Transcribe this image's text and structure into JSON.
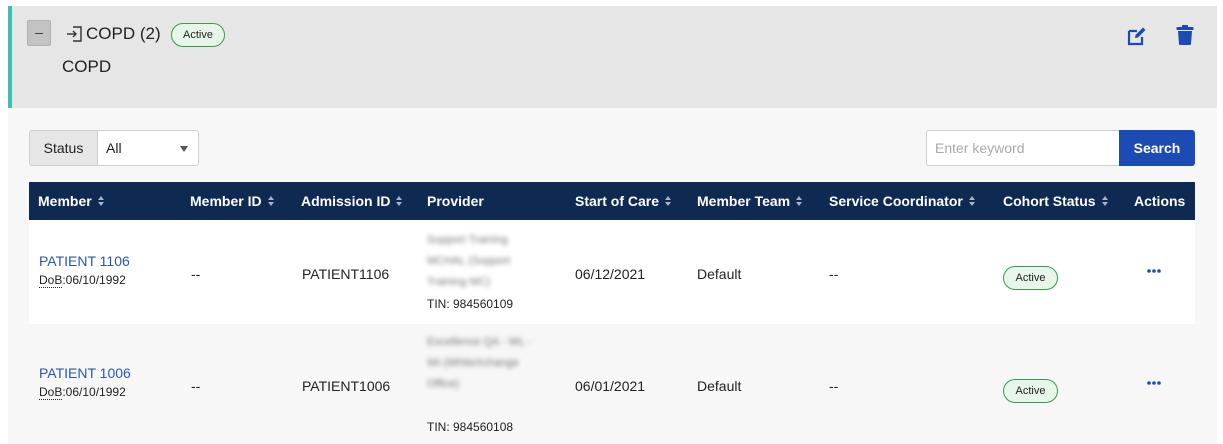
{
  "cohort": {
    "collapse_label": "–",
    "title": "COPD (2)",
    "status_badge": "Active",
    "subtitle": "COPD",
    "icons": {
      "enter": "sign-in-icon",
      "edit": "edit-icon",
      "delete": "trash-icon"
    },
    "colors": {
      "accent": "#3dbfb1",
      "header_bg": "#e6e6e6",
      "icon": "#1c4cb3"
    }
  },
  "filters": {
    "status_label": "Status",
    "status_value": "All",
    "search_placeholder": "Enter keyword",
    "search_button": "Search"
  },
  "table": {
    "columns": [
      {
        "label": "Member",
        "sortable": true
      },
      {
        "label": "Member ID",
        "sortable": true
      },
      {
        "label": "Admission ID",
        "sortable": true
      },
      {
        "label": "Provider",
        "sortable": false
      },
      {
        "label": "Start of Care",
        "sortable": true
      },
      {
        "label": "Member Team",
        "sortable": true
      },
      {
        "label": "Service Coordinator",
        "sortable": true
      },
      {
        "label": "Cohort Status",
        "sortable": true
      },
      {
        "label": "Actions",
        "sortable": false
      }
    ],
    "rows": [
      {
        "member_name": "PATIENT 1106",
        "dob_label": "DoB",
        "dob_value": ":06/10/1992",
        "member_id": "--",
        "admission_id": "PATIENT1106",
        "provider_name": "Support Training MCHAL (Support Training MC)",
        "provider_tin": "TIN: 984560109",
        "start_of_care": "06/12/2021",
        "member_team": "Default",
        "service_coordinator": "--",
        "cohort_status": "Active"
      },
      {
        "member_name": "PATIENT 1006",
        "dob_label": "DoB",
        "dob_value": ":06/10/1992",
        "member_id": "--",
        "admission_id": "PATIENT1006",
        "provider_name": "Excellence QA - WL - WI (WhiteXchange Office)",
        "provider_tin": "TIN: 984560108",
        "start_of_care": "06/01/2021",
        "member_team": "Default",
        "service_coordinator": "--",
        "cohort_status": "Active"
      }
    ],
    "colors": {
      "header_bg": "#0e2a52",
      "link": "#2b55b5",
      "badge_border": "#3a9a4c"
    }
  }
}
